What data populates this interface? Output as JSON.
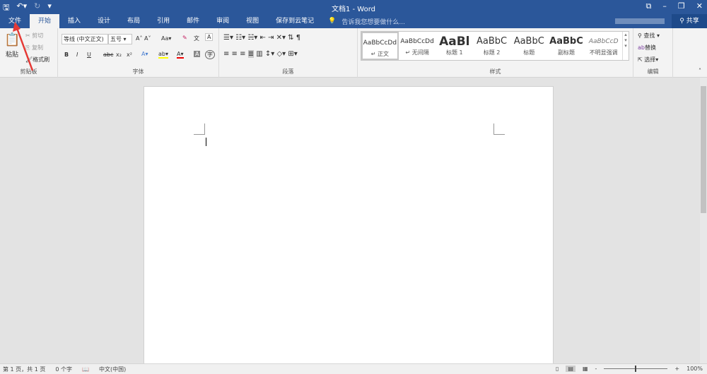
{
  "title": "文档1 - Word",
  "qat": {
    "save": "save-icon",
    "undo": "undo-icon",
    "redo": "redo-icon"
  },
  "tabs": [
    "文件",
    "开始",
    "插入",
    "设计",
    "布局",
    "引用",
    "邮件",
    "审阅",
    "视图",
    "保存到云笔记"
  ],
  "tellme": "告诉我您想要做什么...",
  "share": "共享",
  "clipboard": {
    "paste": "粘贴",
    "cut": "剪切",
    "copy": "复制",
    "format_painter": "格式刷",
    "label": "剪贴板"
  },
  "font": {
    "name": "等线 (中文正文)",
    "size": "五号",
    "case": "Aa",
    "label": "字体",
    "bold": "B",
    "italic": "I",
    "underline": "U",
    "strike": "abc",
    "sub": "x₂",
    "sup": "x²"
  },
  "paragraph": {
    "label": "段落"
  },
  "styles": {
    "label": "样式",
    "items": [
      {
        "preview": "AaBbCcDd",
        "name": "↵ 正文"
      },
      {
        "preview": "AaBbCcDd",
        "name": "↵ 无间隔"
      },
      {
        "preview": "AaBl",
        "name": "标题 1"
      },
      {
        "preview": "AaBbC",
        "name": "标题 2"
      },
      {
        "preview": "AaBbC",
        "name": "标题"
      },
      {
        "preview": "AaBbC",
        "name": "副标题"
      },
      {
        "preview": "AaBbCcD",
        "name": "不明显强调"
      }
    ]
  },
  "editing": {
    "find": "查找",
    "replace": "替换",
    "select": "选择",
    "label": "编辑"
  },
  "status": {
    "page": "第 1 页，共 1 页",
    "words": "0 个字",
    "lang": "中文(中国)",
    "zoom": "100%"
  },
  "annotation_color": "#e53935"
}
